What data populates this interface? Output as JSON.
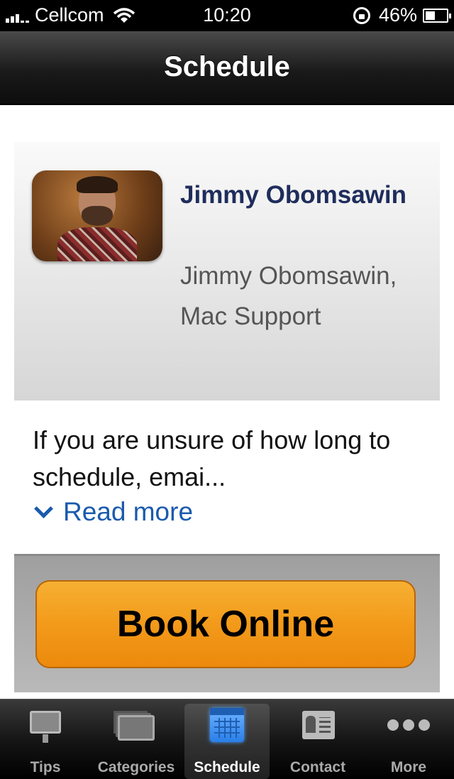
{
  "status_bar": {
    "carrier": "Cellcom",
    "time": "10:20",
    "battery": "46%",
    "icons": [
      "signal-icon",
      "wifi-icon",
      "rotation-lock-icon",
      "battery-icon"
    ]
  },
  "nav": {
    "title": "Schedule"
  },
  "profile": {
    "name": "Jimmy Obomsawin",
    "role": "Jimmy Obomsawin, Mac Support"
  },
  "description": {
    "text": "If you are unsure of how long to schedule, emai...",
    "read_more": "Read more"
  },
  "actions": {
    "book_label": "Book Online"
  },
  "tabs": [
    {
      "label": "Tips",
      "icon": "monitor-icon"
    },
    {
      "label": "Categories",
      "icon": "categories-icon"
    },
    {
      "label": "Schedule",
      "icon": "calendar-icon",
      "active": true
    },
    {
      "label": "Contact",
      "icon": "contact-card-icon"
    },
    {
      "label": "More",
      "icon": "more-dots-icon"
    }
  ],
  "colors": {
    "accent_orange": "#f39a1a",
    "name_blue": "#1f2d5c",
    "link_blue": "#1a5aad"
  }
}
